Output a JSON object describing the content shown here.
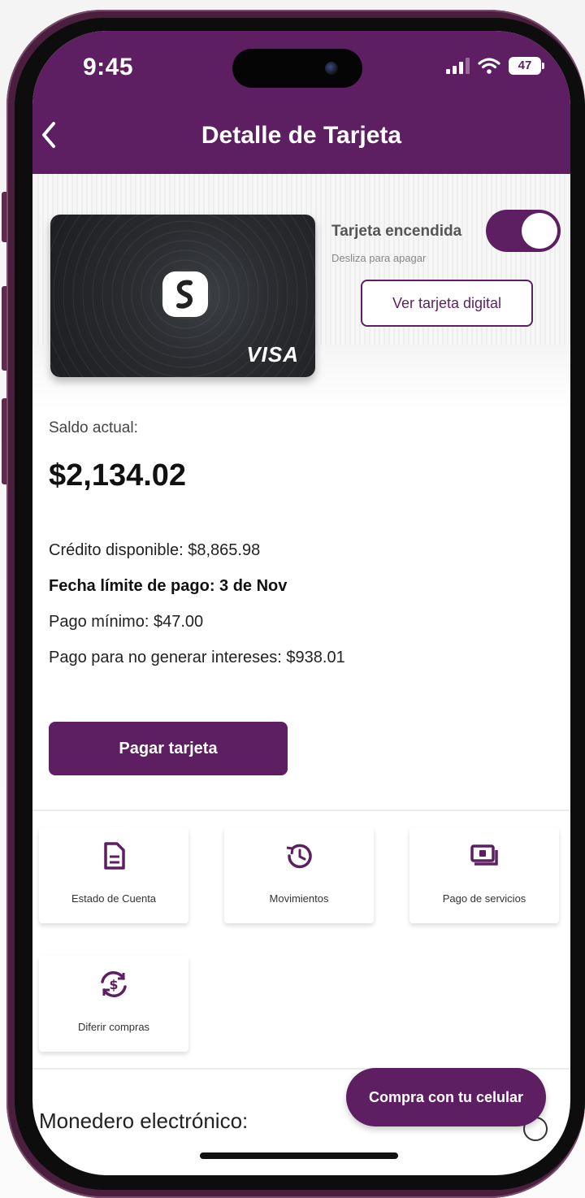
{
  "status_bar": {
    "time": "9:45",
    "battery": "47"
  },
  "header": {
    "title": "Detalle de Tarjeta"
  },
  "card": {
    "brand": "VISA",
    "toggle_label": "Tarjeta encendida",
    "toggle_hint": "Desliza para apagar",
    "toggle_on": true,
    "digital_button": "Ver tarjeta digital"
  },
  "balance": {
    "label": "Saldo actual:",
    "value": "$2,134.02",
    "credit_available": "Crédito disponible: $8,865.98",
    "due_date": "Fecha límite de pago: 3 de Nov",
    "minimum_payment": "Pago mínimo: $47.00",
    "no_interest_payment": "Pago para no generar intereses: $938.01"
  },
  "pay_button": "Pagar tarjeta",
  "tiles": [
    {
      "label": "Estado de Cuenta",
      "icon": "document-icon"
    },
    {
      "label": "Movimientos",
      "icon": "history-icon"
    },
    {
      "label": "Pago de servicios",
      "icon": "payment-icon"
    },
    {
      "label": "Diferir compras",
      "icon": "defer-dollar-icon"
    }
  ],
  "monedero": {
    "label": "Monedero electrónico:"
  },
  "fab": {
    "label": "Compra con tu celular"
  },
  "colors": {
    "primary": "#5d1f62",
    "frame": "#4a1f3e"
  }
}
